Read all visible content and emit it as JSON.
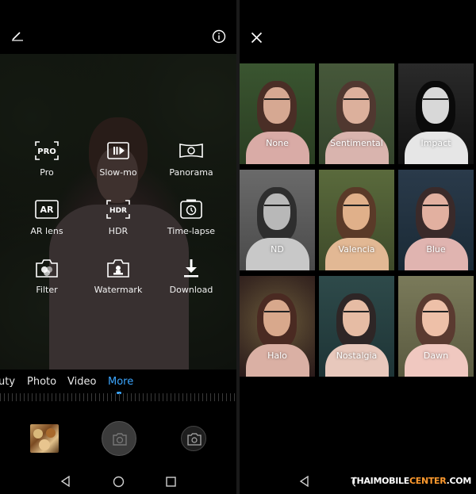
{
  "camera": {
    "modes": [
      {
        "label": "Pro",
        "icon": "pro-icon",
        "badge": "PRO"
      },
      {
        "label": "Slow-mo",
        "icon": "slow-mo-icon"
      },
      {
        "label": "Panorama",
        "icon": "panorama-icon"
      },
      {
        "label": "AR lens",
        "icon": "ar-lens-icon",
        "badge": "AR"
      },
      {
        "label": "HDR",
        "icon": "hdr-icon",
        "badge": "HDR"
      },
      {
        "label": "Time-lapse",
        "icon": "time-lapse-icon"
      },
      {
        "label": "Filter",
        "icon": "filter-icon"
      },
      {
        "label": "Watermark",
        "icon": "watermark-icon"
      },
      {
        "label": "Download",
        "icon": "download-icon"
      }
    ],
    "mode_tabs": [
      {
        "label": "uty",
        "active": false
      },
      {
        "label": "Photo",
        "active": false
      },
      {
        "label": "Video",
        "active": false
      },
      {
        "label": "More",
        "active": true
      }
    ],
    "accent_color": "#3ba6ff"
  },
  "filters": {
    "items": [
      {
        "label": "None",
        "selected": false
      },
      {
        "label": "Sentimental",
        "selected": false
      },
      {
        "label": "Impact",
        "selected": false
      },
      {
        "label": "ND",
        "selected": false
      },
      {
        "label": "Valencia",
        "selected": true
      },
      {
        "label": "Blue",
        "selected": false
      },
      {
        "label": "Halo",
        "selected": false
      },
      {
        "label": "Nostalgia",
        "selected": false
      },
      {
        "label": "Dawn",
        "selected": false
      }
    ],
    "selected_color": "#2d8ee6"
  },
  "watermark": {
    "prefix": "THAIMOBILE",
    "highlight": "CENTER",
    "suffix": ".COM"
  }
}
